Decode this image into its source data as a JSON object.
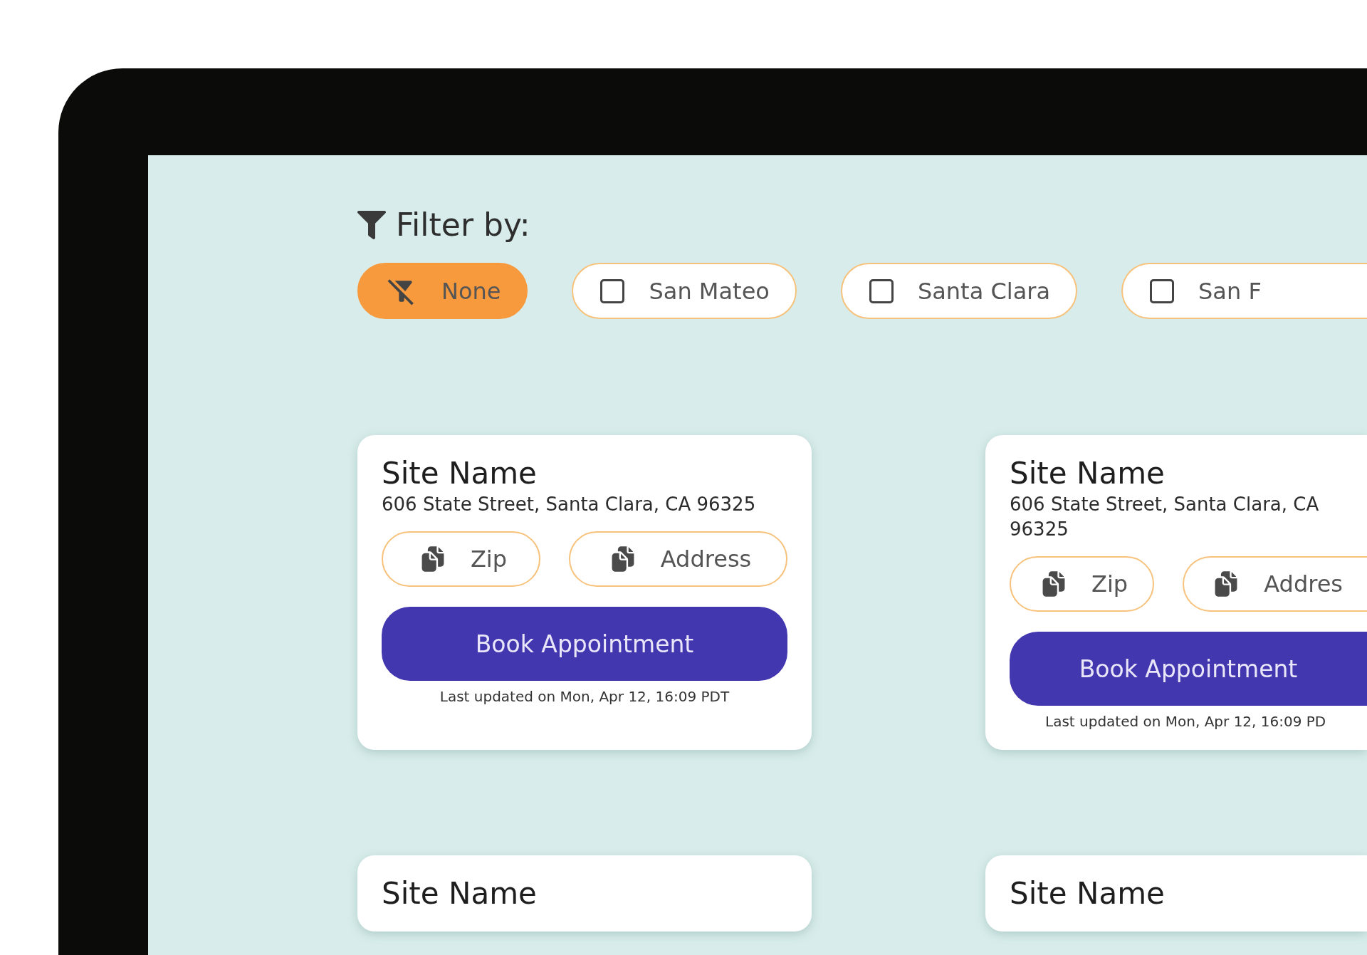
{
  "filter": {
    "label": "Filter by:",
    "chips": [
      {
        "kind": "clear",
        "label": "None",
        "selected": true
      },
      {
        "kind": "checkbox",
        "label": "San Mateo",
        "selected": false
      },
      {
        "kind": "checkbox",
        "label": "Santa Clara",
        "selected": false
      },
      {
        "kind": "checkbox",
        "label": "San F",
        "selected": false
      }
    ]
  },
  "cards": [
    {
      "title": "Site Name",
      "address": "606 State Street, Santa Clara, CA 96325",
      "copy_buttons": [
        "Zip",
        "Address"
      ],
      "action": "Book Appointment",
      "updated": "Last updated on Mon, Apr 12, 16:09 PDT"
    },
    {
      "title": "Site Name",
      "address": "606 State Street, Santa Clara, CA 96325",
      "copy_buttons": [
        "Zip",
        "Addres"
      ],
      "action": "Book Appointment",
      "updated": "Last updated on Mon, Apr 12, 16:09 PD"
    },
    {
      "title": "Site Name"
    },
    {
      "title": "Site Name"
    }
  ]
}
